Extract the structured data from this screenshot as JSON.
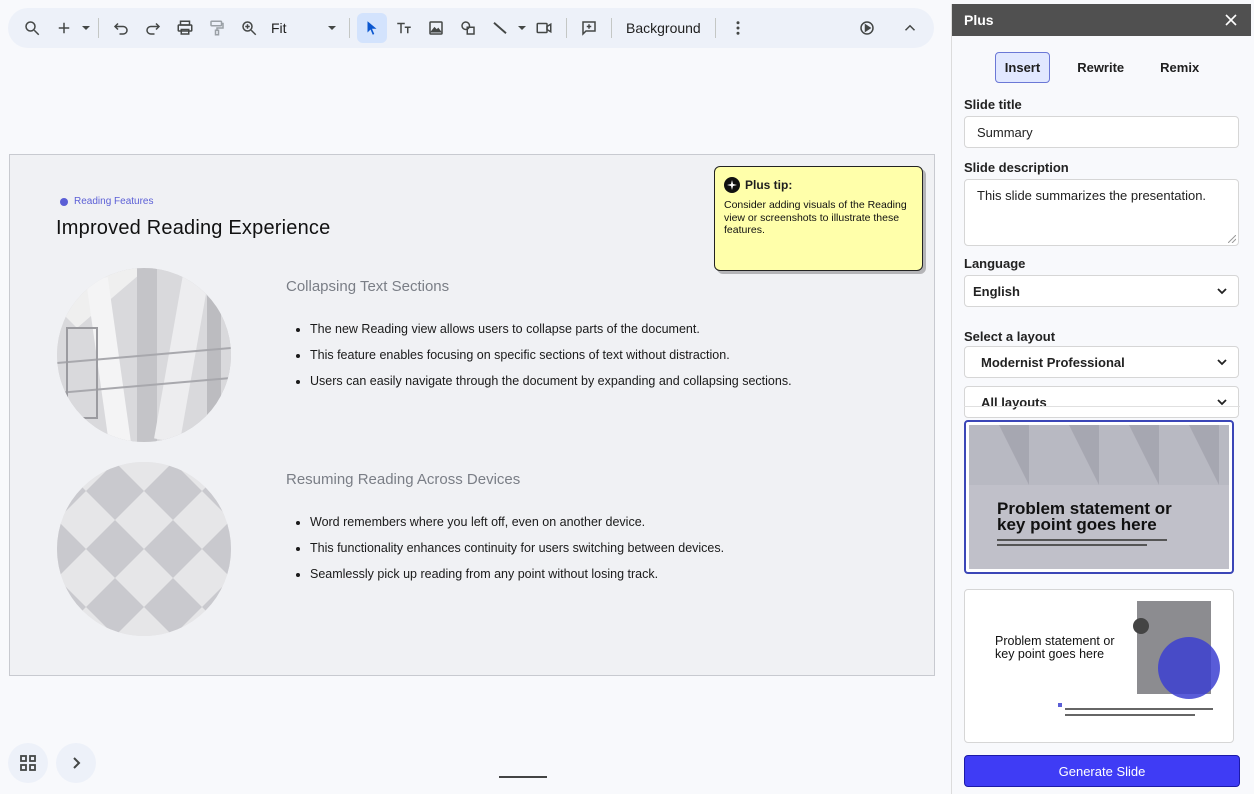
{
  "toolbar": {
    "zoom_value": "Fit",
    "background_label": "Background",
    "icons": [
      "search-icon",
      "add-icon",
      "undo-icon",
      "redo-icon",
      "print-icon",
      "paint-format-icon",
      "zoom-icon",
      "select-icon",
      "text-box-icon",
      "image-icon",
      "shape-icon",
      "line-icon",
      "video-icon",
      "comment-icon",
      "more-icon",
      "present-icon",
      "collapse-icon"
    ]
  },
  "slide": {
    "eyebrow": "Reading Features",
    "title": "Improved Reading Experience",
    "sections": [
      {
        "heading": "Collapsing Text Sections",
        "bullets": [
          "The new Reading view allows users to collapse parts of the document.",
          "This feature enables focusing on specific sections of text without distraction.",
          "Users can easily navigate through the document by expanding and collapsing sections."
        ]
      },
      {
        "heading": "Resuming Reading Across Devices",
        "bullets": [
          "Word remembers where you left off, even on another device.",
          "This functionality enhances continuity for users switching between devices.",
          "Seamlessly pick up reading from any point without losing track."
        ]
      }
    ]
  },
  "tip": {
    "title": "Plus tip:",
    "body": "Consider adding visuals of the Reading view or screenshots to illustrate these features."
  },
  "panel": {
    "title": "Plus",
    "tabs": [
      {
        "label": "Insert",
        "active": true
      },
      {
        "label": "Rewrite",
        "active": false
      },
      {
        "label": "Remix",
        "active": false
      }
    ],
    "slide_title_label": "Slide title",
    "slide_title_value": "Summary",
    "slide_desc_label": "Slide description",
    "slide_desc_value": "This slide summarizes the presentation.",
    "language_label": "Language",
    "language_value": "English",
    "layout_label": "Select a layout",
    "layout_value": "Modernist Professional",
    "layout_filter_value": "All layouts",
    "thumb1_text": "Problem statement or key point goes here",
    "thumb2_text": "Problem statement or key point goes here",
    "generate_label": "Generate Slide"
  },
  "colors": {
    "accent": "#3f3cf5",
    "tip_bg": "#ffffaa",
    "panel_header": "#505050"
  }
}
